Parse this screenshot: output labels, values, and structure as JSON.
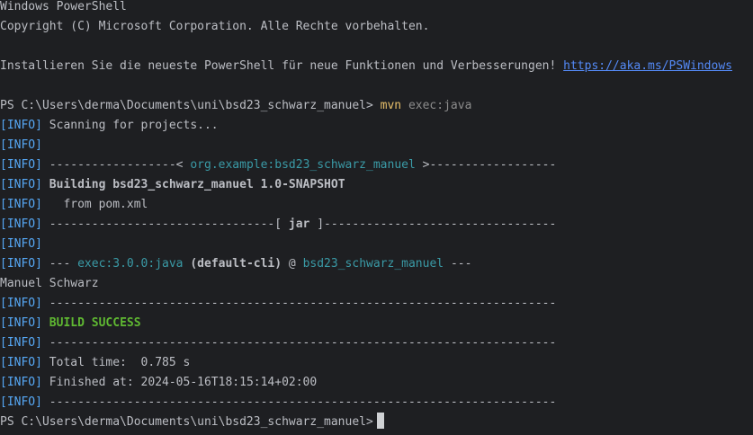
{
  "header": {
    "title": "Windows PowerShell",
    "copyright": "Copyright (C) Microsoft Corporation. Alle Rechte vorbehalten.",
    "install_text": "Installieren Sie die neueste PowerShell für neue Funktionen und Verbesserungen! ",
    "install_link": "https://aka.ms/PSWindows"
  },
  "prompt": {
    "path": "PS C:\\Users\\derma\\Documents\\uni\\bsd23_schwarz_manuel> ",
    "command": "mvn",
    "args": " exec:java"
  },
  "output": {
    "info_tag": "[INFO]",
    "scanning": " Scanning for projects...",
    "dashes_left": " ------------------< ",
    "artifact": "org.example:bsd23_schwarz_manuel",
    "dashes_right": " >------------------",
    "building": " Building bsd23_schwarz_manuel 1.0-SNAPSHOT",
    "from_pom": "   from pom.xml",
    "jar_left": " --------------------------------[ ",
    "jar": "jar",
    "jar_right": " ]---------------------------------",
    "exec_prefix": " --- ",
    "plugin": "exec:3.0.0:java",
    "execution": " (default-cli)",
    "at": " @ ",
    "project": "bsd23_schwarz_manuel",
    "exec_suffix": " ---",
    "program_output": "Manuel Schwarz",
    "separator": " ------------------------------------------------------------------------",
    "build_success": "BUILD SUCCESS",
    "total_time": " Total time:  0.785 s",
    "finished_at": " Finished at: 2024-05-16T18:15:14+02:00"
  },
  "final_prompt": {
    "path": "PS C:\\Users\\derma\\Documents\\uni\\bsd23_schwarz_manuel>"
  },
  "colors": {
    "background": "#1e1f22",
    "text": "#bcbec4",
    "info_tag": "#56a8f5",
    "command": "#e8bf6a",
    "artifact": "#3a9aa6",
    "success": "#5fb832",
    "link": "#548af7"
  }
}
